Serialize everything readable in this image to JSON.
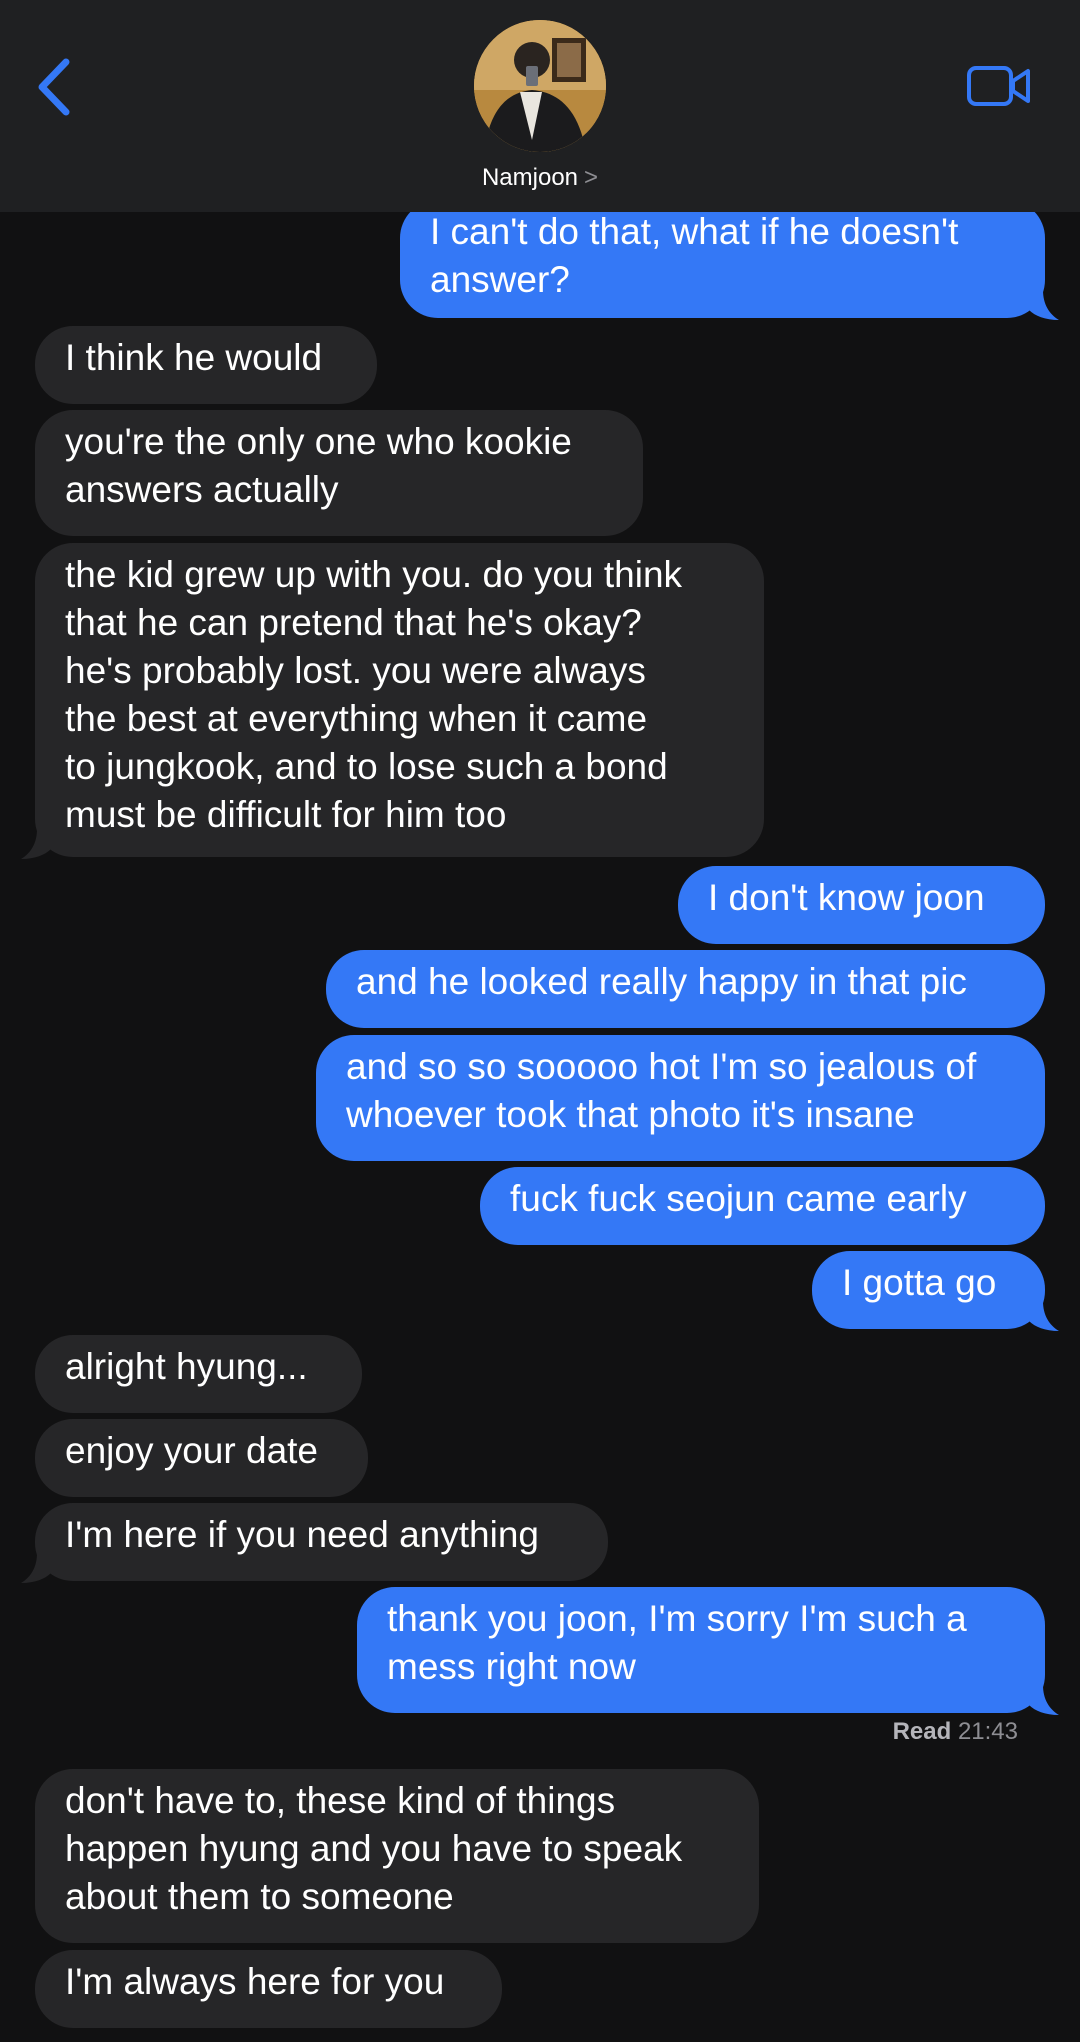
{
  "header": {
    "back_icon": "chevron-left-icon",
    "contact_name": "Namjoon",
    "contact_chevron": ">",
    "video_icon": "video-camera-icon",
    "accent_color": "#3478f6"
  },
  "messages": [
    {
      "dir": "out",
      "text": "I can't do that, what if he doesn't\nanswer?",
      "tail": true
    },
    {
      "dir": "in",
      "text": "I think he would",
      "tail": false
    },
    {
      "dir": "in",
      "text": "you're the only one who kookie\nanswers actually",
      "tail": false
    },
    {
      "dir": "in",
      "text": "the kid grew up with you. do you think\nthat he can pretend that he's okay?\nhe's probably lost. you were always\nthe best at everything when it came\nto jungkook, and to lose such a bond\nmust be difficult for him too",
      "tail": true
    },
    {
      "dir": "out",
      "text": "I don't know joon",
      "tail": false
    },
    {
      "dir": "out",
      "text": "and he looked really happy in that pic",
      "tail": false
    },
    {
      "dir": "out",
      "text": "and so so sooooo hot I'm so jealous of\nwhoever took that photo it's insane",
      "tail": false
    },
    {
      "dir": "out",
      "text": "fuck fuck seojun came early",
      "tail": false
    },
    {
      "dir": "out",
      "text": "I gotta go",
      "tail": true
    },
    {
      "dir": "in",
      "text": "alright hyung...",
      "tail": false
    },
    {
      "dir": "in",
      "text": "enjoy your date",
      "tail": false
    },
    {
      "dir": "in",
      "text": "I'm here if you need anything",
      "tail": true
    },
    {
      "dir": "out",
      "text": "thank you joon, I'm sorry I'm such a\nmess right now",
      "tail": true
    },
    {
      "dir": "in",
      "text": "don't have to, these kind of things\nhappen hyung and you have to speak\nabout them to someone",
      "tail": false
    },
    {
      "dir": "in",
      "text": "I'm always here for you",
      "tail": false
    }
  ],
  "read_receipt": {
    "label": "Read",
    "time": "21:43"
  },
  "colors": {
    "outgoing_bubble": "#3478f6",
    "incoming_bubble": "#262628",
    "background": "#111112"
  }
}
